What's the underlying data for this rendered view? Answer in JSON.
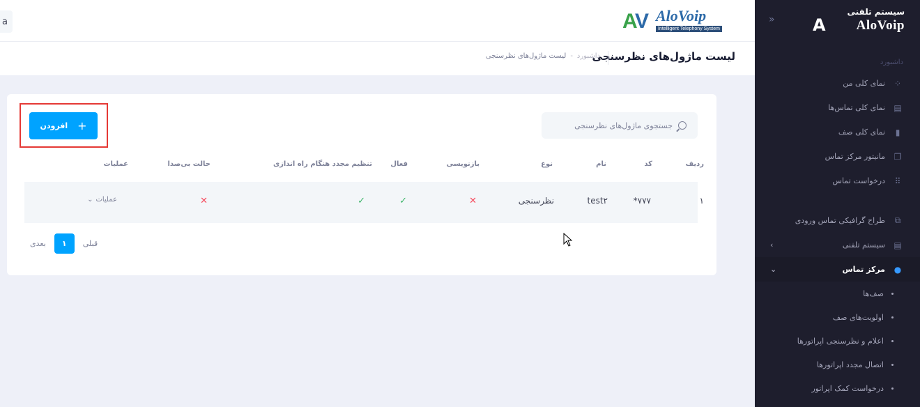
{
  "sidebar": {
    "brand_line1": "سیستم تلفنی",
    "brand_line2": "AloVoip",
    "section_label": "داشبورد",
    "dashboard_items": [
      {
        "label": "نمای کلی من",
        "icon": "diamond-dots-icon"
      },
      {
        "label": "نمای کلی تماس‌ها",
        "icon": "book-icon"
      },
      {
        "label": "نمای کلی صف",
        "icon": "bars-icon"
      },
      {
        "label": "مانیتور مرکز تماس",
        "icon": "copy-icon"
      },
      {
        "label": "درخواست تماس",
        "icon": "grid-icon"
      }
    ],
    "main_items": [
      {
        "label": "طراح گرافیکی تماس ورودی",
        "icon": "diagram-icon"
      },
      {
        "label": "سیستم تلفنی",
        "icon": "book-icon"
      },
      {
        "label": "مرکز تماس",
        "icon": "headset-user-icon"
      }
    ],
    "sub_items": [
      "صف‌ها",
      "اولویت‌های صف",
      "اعلام و نظرسنجی اپراتورها",
      "اتصال مجدد اپراتورها",
      "درخواست کمک اپراتور"
    ]
  },
  "header": {
    "logo_name": "AloVoip",
    "logo_tag": "Intelligent Telephony System",
    "left_button": "a"
  },
  "subheader": {
    "title": "لیست ماژول‌های نظرسنجی",
    "breadcrumb": [
      "داشبورد",
      "-",
      "لیست ماژول‌های نظرسنجی"
    ]
  },
  "toolbar": {
    "search_placeholder": "جستجوی ماژول‌های نظرسنجی",
    "add_label": "افزودن"
  },
  "table": {
    "headers": [
      "ردیف",
      "کد",
      "نام",
      "نوع",
      "بازنویسی",
      "فعال",
      "تنظیم مجدد هنگام راه اندازی",
      "حالت بی‌صدا",
      "عملیات"
    ],
    "rows": [
      {
        "index": "۱",
        "code": "۷۷۷*",
        "name": "test۲",
        "type": "نظرسنجی",
        "overwrite": false,
        "active": true,
        "reset_on_start": true,
        "mute": false,
        "actions": "عملیات"
      }
    ]
  },
  "pagination": {
    "prev": "قبلی",
    "page": "۱",
    "next": "بعدی"
  }
}
